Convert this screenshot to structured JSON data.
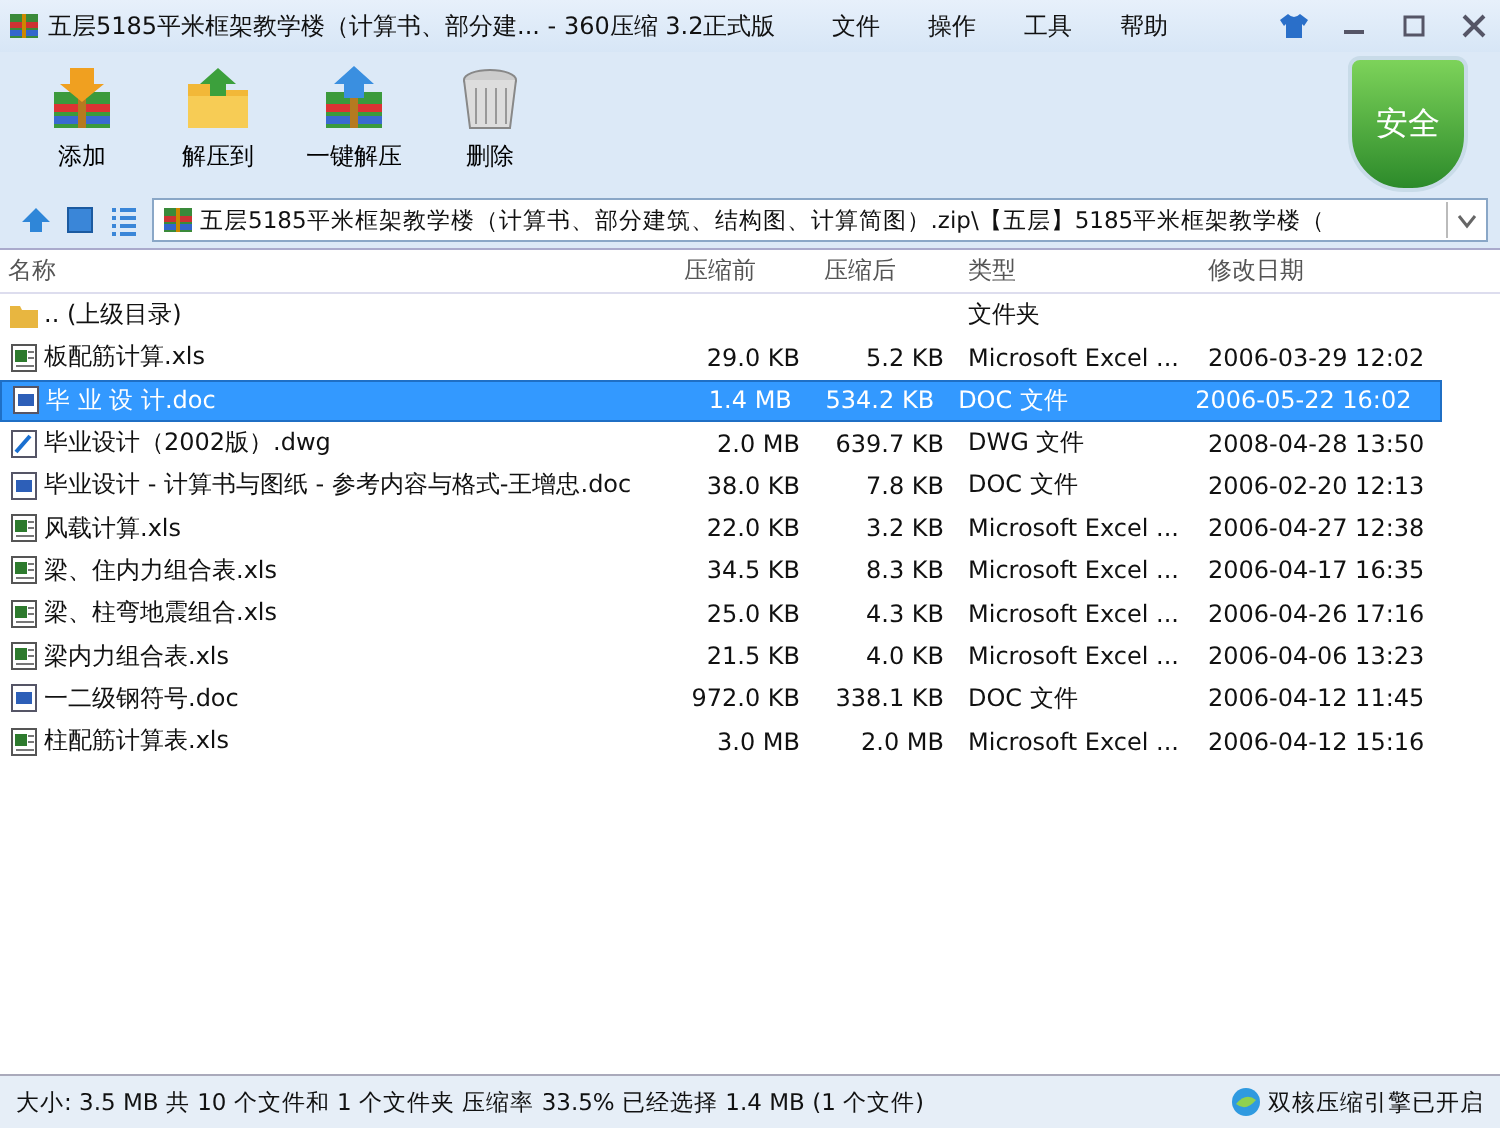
{
  "window": {
    "title": "五层5185平米框架教学楼（计算书、部分建... - 360压缩 3.2正式版"
  },
  "menu": [
    "文件",
    "操作",
    "工具",
    "帮助"
  ],
  "toolbar": [
    {
      "label": "添加",
      "kind": "add"
    },
    {
      "label": "解压到",
      "kind": "extract"
    },
    {
      "label": "一键解压",
      "kind": "oneclick"
    },
    {
      "label": "删除",
      "kind": "delete"
    }
  ],
  "security_badge": "安全",
  "address": {
    "value": "五层5185平米框架教学楼（计算书、部分建筑、结构图、计算简图）.zip\\【五层】5185平米框架教学楼（"
  },
  "table": {
    "columns": [
      "名称",
      "压缩前",
      "压缩后",
      "类型",
      "修改日期"
    ],
    "rows": [
      {
        "kind": "folder",
        "name": ".. (上级目录)",
        "size": "",
        "packed": "",
        "type": "文件夹",
        "date": "",
        "selected": false
      },
      {
        "kind": "xls",
        "name": "板配筋计算.xls",
        "size": "29.0 KB",
        "packed": "5.2 KB",
        "type": "Microsoft Excel ...",
        "date": "2006-03-29 12:02",
        "selected": false
      },
      {
        "kind": "doc",
        "name": "毕 业 设 计.doc",
        "size": "1.4 MB",
        "packed": "534.2 KB",
        "type": "DOC 文件",
        "date": "2006-05-22 16:02",
        "selected": true
      },
      {
        "kind": "dwg",
        "name": "毕业设计（2002版）.dwg",
        "size": "2.0 MB",
        "packed": "639.7 KB",
        "type": "DWG 文件",
        "date": "2008-04-28 13:50",
        "selected": false
      },
      {
        "kind": "doc",
        "name": "毕业设计 - 计算书与图纸 - 参考内容与格式-王增忠.doc",
        "size": "38.0 KB",
        "packed": "7.8 KB",
        "type": "DOC 文件",
        "date": "2006-02-20 12:13",
        "selected": false
      },
      {
        "kind": "xls",
        "name": "风载计算.xls",
        "size": "22.0 KB",
        "packed": "3.2 KB",
        "type": "Microsoft Excel ...",
        "date": "2006-04-27 12:38",
        "selected": false
      },
      {
        "kind": "xls",
        "name": "梁、住内力组合表.xls",
        "size": "34.5 KB",
        "packed": "8.3 KB",
        "type": "Microsoft Excel ...",
        "date": "2006-04-17 16:35",
        "selected": false
      },
      {
        "kind": "xls",
        "name": "梁、柱弯地震组合.xls",
        "size": "25.0 KB",
        "packed": "4.3 KB",
        "type": "Microsoft Excel ...",
        "date": "2006-04-26 17:16",
        "selected": false
      },
      {
        "kind": "xls",
        "name": "梁内力组合表.xls",
        "size": "21.5 KB",
        "packed": "4.0 KB",
        "type": "Microsoft Excel ...",
        "date": "2006-04-06 13:23",
        "selected": false
      },
      {
        "kind": "doc",
        "name": "一二级钢符号.doc",
        "size": "972.0 KB",
        "packed": "338.1 KB",
        "type": "DOC 文件",
        "date": "2006-04-12 11:45",
        "selected": false
      },
      {
        "kind": "xls",
        "name": "柱配筋计算表.xls",
        "size": "3.0 MB",
        "packed": "2.0 MB",
        "type": "Microsoft Excel ...",
        "date": "2006-04-12 15:16",
        "selected": false
      }
    ]
  },
  "status_bar": {
    "summary": "大小: 3.5 MB 共 10 个文件和 1 个文件夹 压缩率 33.5% 已经选择 1.4 MB (1 个文件)",
    "engine": "双核压缩引擎已开启"
  }
}
